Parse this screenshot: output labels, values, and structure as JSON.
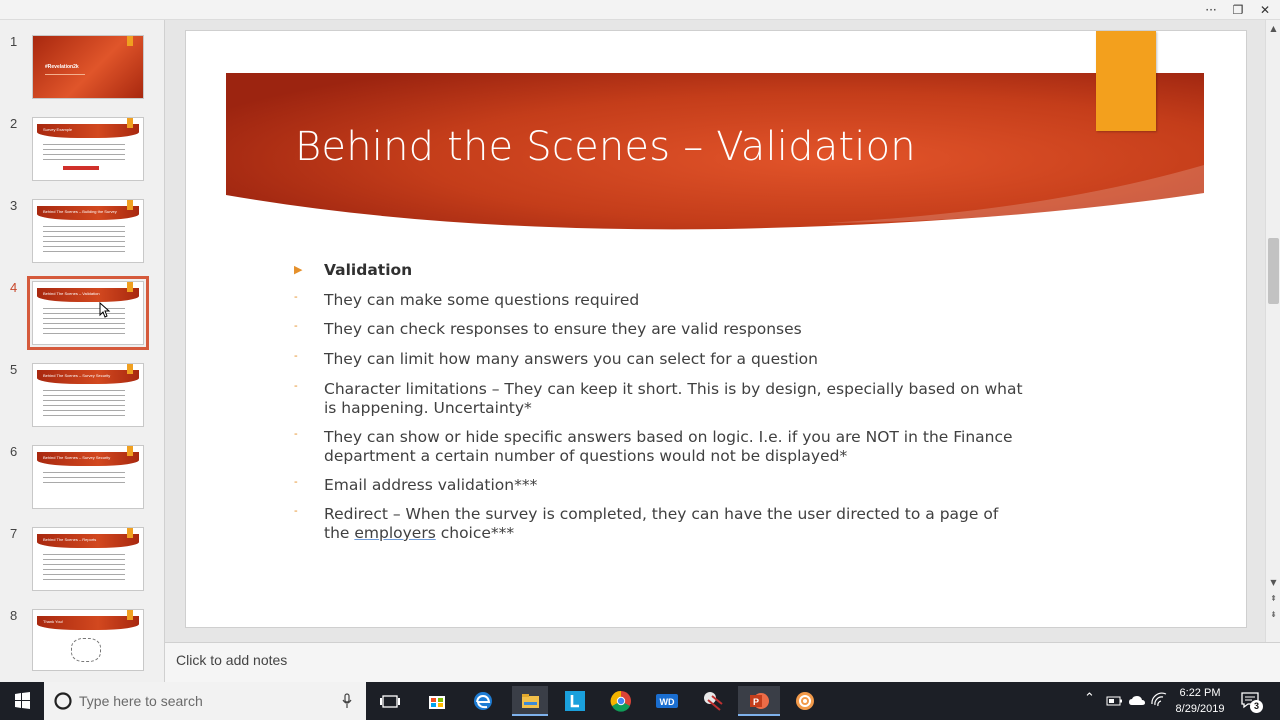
{
  "window": {
    "more_glyph": "···",
    "restore_glyph": "❐",
    "close_glyph": "✕"
  },
  "thumbnails": [
    {
      "number": "1",
      "title": "#Revelation2k"
    },
    {
      "number": "2",
      "title": "Survey Example"
    },
    {
      "number": "3",
      "title": "Behind The Scenes – Building the Survey"
    },
    {
      "number": "4",
      "title": "Behind The Scenes – Validation"
    },
    {
      "number": "5",
      "title": "Behind The Scenes – Survey Security"
    },
    {
      "number": "6",
      "title": "Behind The Scenes – Survey Security"
    },
    {
      "number": "7",
      "title": "Behind The Scenes – Reports"
    },
    {
      "number": "8",
      "title": "Thank You!"
    }
  ],
  "slide": {
    "title": "Behind the Scenes – Validation",
    "bullets": [
      {
        "mark": "▶",
        "text": "Validation",
        "bold": true
      },
      {
        "mark": "-",
        "text": "They can make some questions required"
      },
      {
        "mark": "-",
        "text": "They can check responses to ensure they are valid responses"
      },
      {
        "mark": "-",
        "text": "They can limit how many answers you can select for a question"
      },
      {
        "mark": "-",
        "text": "Character limitations – They can keep it short. This is by design, especially based on what is happening. Uncertainty*"
      },
      {
        "mark": "-",
        "text": "They can show or hide specific answers based on logic. I.e. if you are NOT in the Finance department a certain number of questions would not be displayed*"
      },
      {
        "mark": "-",
        "text": "Email address validation***"
      },
      {
        "mark": "-",
        "text_before": "Redirect – When the survey is completed, they can have the user directed to a page of the ",
        "underlined": "employers",
        "text_after": " choice***"
      }
    ]
  },
  "notes": {
    "placeholder": "Click to add notes"
  },
  "scrollbar": {
    "up": "▲",
    "down": "▼",
    "prev": "⇞",
    "next": "⇟"
  },
  "taskbar": {
    "search_placeholder": "Type here to search",
    "clock_time": "6:22 PM",
    "clock_date": "8/29/2019",
    "notification_count": "3",
    "colors": {
      "accent": "#7fb2ec",
      "background": "#1c1f26"
    }
  },
  "colors": {
    "banner_dark": "#a8280f",
    "banner_light": "#e2542a",
    "accent_tab": "#f3a01d",
    "bullet": "#e5902b"
  }
}
